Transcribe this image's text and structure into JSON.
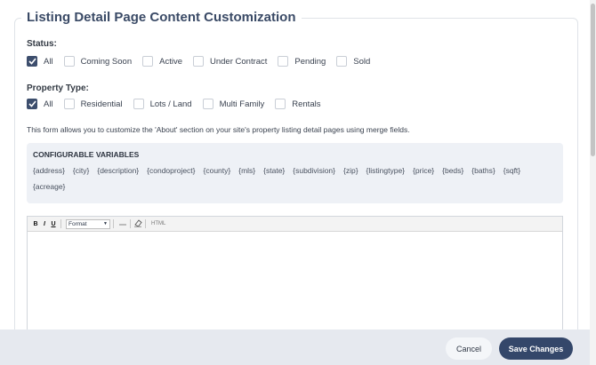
{
  "title": "Listing Detail Page Content Customization",
  "status": {
    "label": "Status:",
    "options": [
      {
        "label": "All",
        "checked": true
      },
      {
        "label": "Coming Soon",
        "checked": false
      },
      {
        "label": "Active",
        "checked": false
      },
      {
        "label": "Under Contract",
        "checked": false
      },
      {
        "label": "Pending",
        "checked": false
      },
      {
        "label": "Sold",
        "checked": false
      }
    ]
  },
  "property_type": {
    "label": "Property Type:",
    "options": [
      {
        "label": "All",
        "checked": true
      },
      {
        "label": "Residential",
        "checked": false
      },
      {
        "label": "Lots / Land",
        "checked": false
      },
      {
        "label": "Multi Family",
        "checked": false
      },
      {
        "label": "Rentals",
        "checked": false
      }
    ]
  },
  "description": "This form allows you to customize the 'About' section on your site's property listing detail pages using merge fields.",
  "variables": {
    "title": "CONFIGURABLE VARIABLES",
    "items": [
      "{address}",
      "{city}",
      "{description}",
      "{condoproject}",
      "{county}",
      "{mls}",
      "{state}",
      "{subdivision}",
      "{zip}",
      "{listingtype}",
      "{price}",
      "{beds}",
      "{baths}",
      "{sqft}",
      "{acreage}"
    ]
  },
  "editor": {
    "bold": "B",
    "italic": "I",
    "underline": "U",
    "format_label": "Format",
    "html_label": "HTML"
  },
  "footer": {
    "cancel": "Cancel",
    "save": "Save Changes"
  }
}
